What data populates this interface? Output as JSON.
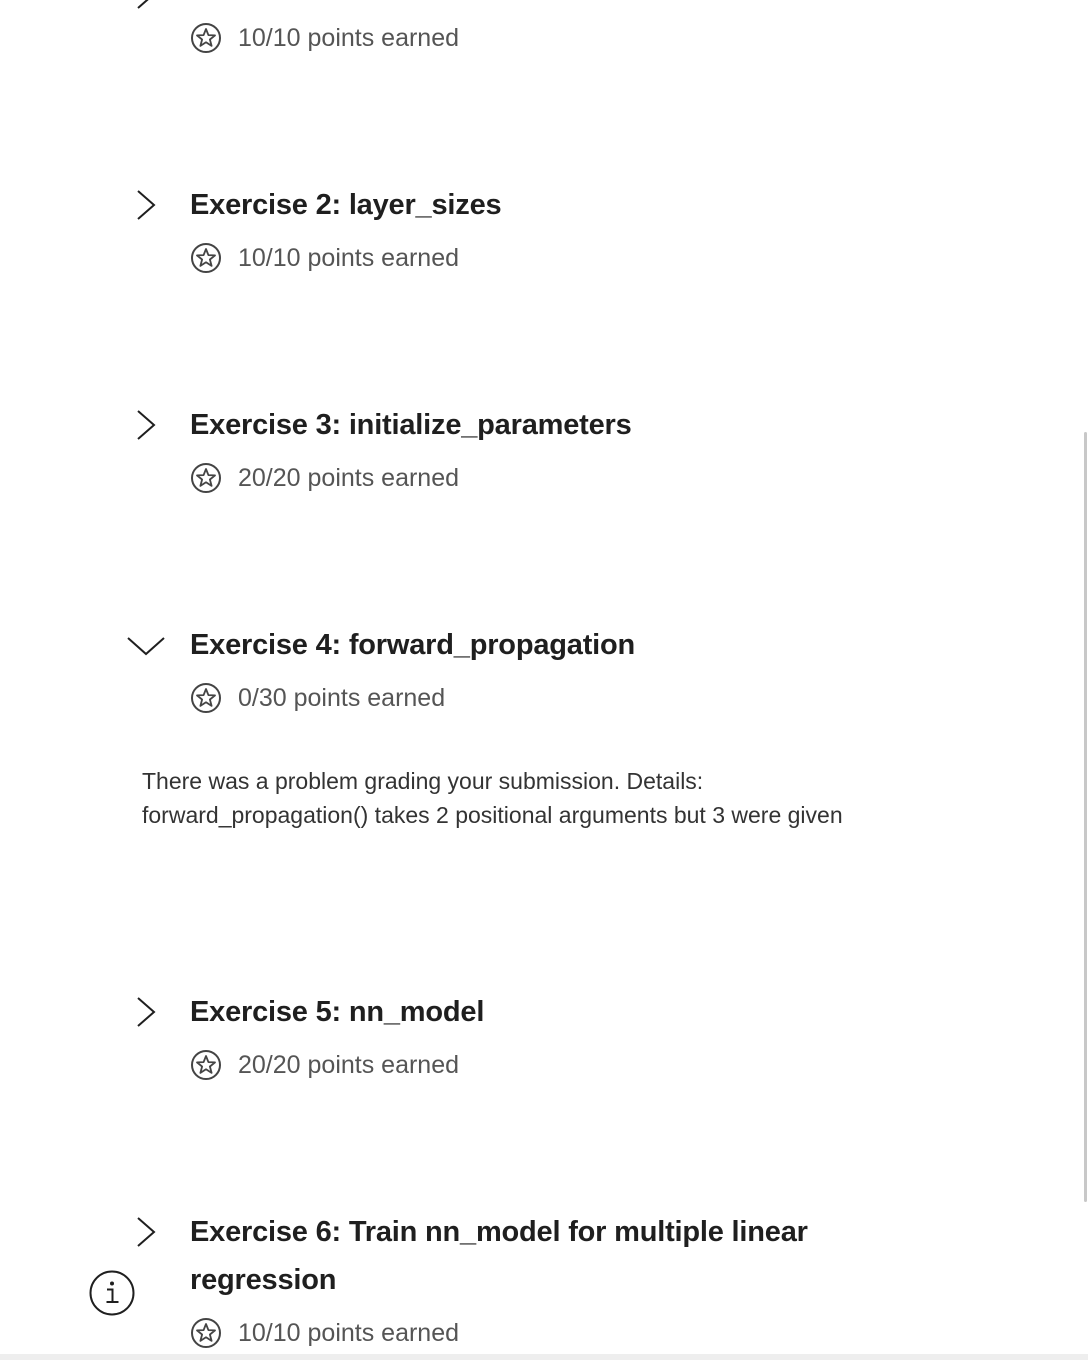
{
  "exercise1": {
    "points": "10/10 points earned"
  },
  "exercises": [
    {
      "title": "Exercise 2: layer_sizes",
      "points": "10/10 points earned",
      "expanded": false
    },
    {
      "title": "Exercise 3: initialize_parameters",
      "points": "20/20 points earned",
      "expanded": false
    },
    {
      "title": "Exercise 4: forward_propagation",
      "points": "0/30 points earned",
      "expanded": true
    },
    {
      "title": "Exercise 5: nn_model",
      "points": "20/20 points earned",
      "expanded": false
    },
    {
      "title": "Exercise 6: Train nn_model for multiple linear regression",
      "points": "10/10 points earned",
      "expanded": false
    }
  ],
  "feedback": {
    "line1": "There was a problem grading your submission. Details:",
    "line2": "forward_propagation() takes 2 positional arguments but 3 were given"
  },
  "icons": {
    "collapsed": "chevron-right-icon",
    "expanded": "chevron-down-icon",
    "points": "star-badge-icon",
    "info": "info-icon"
  },
  "colors": {
    "title": "#1f1f1f",
    "points_text": "#555555",
    "body_text": "#333333"
  }
}
